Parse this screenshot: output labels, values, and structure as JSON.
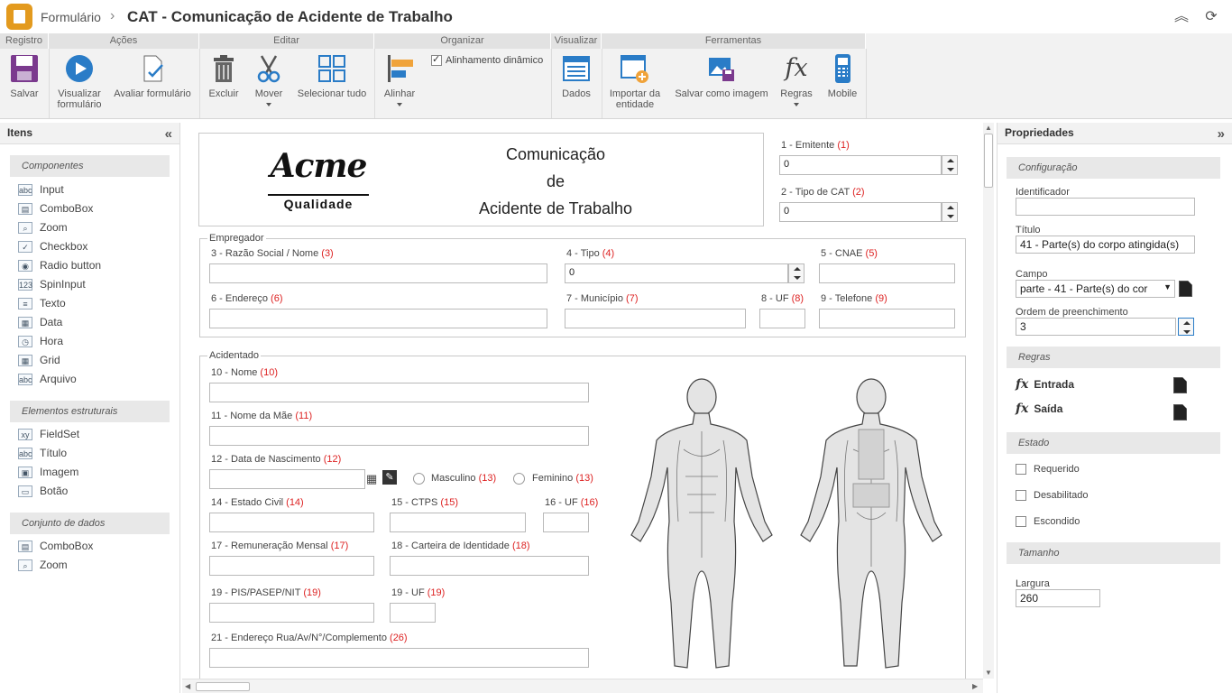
{
  "header": {
    "breadcrumb": "Formulário",
    "title": "CAT - Comunicação de Acidente de Trabalho"
  },
  "ribbon": {
    "groups": [
      "Registro",
      "Ações",
      "Editar",
      "Organizar",
      "Visualizar",
      "Ferramentas"
    ],
    "save": "Salvar",
    "preview": "Visualizar formulário",
    "evaluate": "Avaliar formulário",
    "delete": "Excluir",
    "move": "Mover",
    "select_all": "Selecionar tudo",
    "align": "Alinhar",
    "dynamic_align": "Alinhamento dinâmico",
    "data": "Dados",
    "import_entity": "Importar da entidade",
    "save_image": "Salvar como imagem",
    "rules": "Regras",
    "mobile": "Mobile"
  },
  "left_panel": {
    "title": "Itens",
    "components_title": "Componentes",
    "components": [
      "Input",
      "ComboBox",
      "Zoom",
      "Checkbox",
      "Radio button",
      "SpinInput",
      "Texto",
      "Data",
      "Hora",
      "Grid",
      "Arquivo"
    ],
    "structural_title": "Elementos estruturais",
    "structural": [
      "FieldSet",
      "Título",
      "Imagem",
      "Botão"
    ],
    "dataset_title": "Conjunto de dados",
    "dataset": [
      "ComboBox",
      "Zoom"
    ]
  },
  "form": {
    "logo_text": "Acme",
    "logo_sub": "Qualidade",
    "heading_line1": "Comunicação",
    "heading_line2": "de",
    "heading_line3": "Acidente de Trabalho",
    "emitente_label": "1 - Emitente",
    "emitente_num": "(1)",
    "emitente_value": "0",
    "tipo_cat_label": "2 - Tipo de CAT",
    "tipo_cat_num": "(2)",
    "tipo_cat_value": "0",
    "empregador_legend": "Empregador",
    "razao_label": "3 - Razão Social / Nome",
    "razao_num": "(3)",
    "tipo_label": "4 - Tipo",
    "tipo_num": "(4)",
    "tipo_value": "0",
    "cnae_label": "5 - CNAE",
    "cnae_num": "(5)",
    "endereco_label": "6 - Endereço",
    "endereco_num": "(6)",
    "municipio_label": "7 - Município",
    "municipio_num": "(7)",
    "uf_label": "8 - UF",
    "uf_num": "(8)",
    "telefone_label": "9 - Telefone",
    "telefone_num": "(9)",
    "acidentado_legend": "Acidentado",
    "nome_label": "10 - Nome",
    "nome_num": "(10)",
    "mae_label": "11 - Nome da Mãe",
    "mae_num": "(11)",
    "nasc_label": "12 - Data de Nascimento",
    "nasc_num": "(12)",
    "masc_label": "Masculino",
    "masc_num": "(13)",
    "fem_label": "Feminino",
    "fem_num": "(13)",
    "civil_label": "14 - Estado Civil",
    "civil_num": "(14)",
    "ctps_label": "15 - CTPS",
    "ctps_num": "(15)",
    "uf16_label": "16 - UF",
    "uf16_num": "(16)",
    "remun_label": "17 - Remuneração Mensal",
    "remun_num": "(17)",
    "rg_label": "18 - Carteira de Identidade",
    "rg_num": "(18)",
    "pis_label": "19 - PIS/PASEP/NIT",
    "pis_num": "(19)",
    "uf19_label": "19 - UF",
    "uf19_num": "(19)",
    "end_rua_label": "21 - Endereço Rua/Av/N°/Complemento",
    "end_rua_num": "(26)"
  },
  "right_panel": {
    "title": "Propriedades",
    "config_title": "Configuração",
    "identificador_label": "Identificador",
    "identificador_value": "",
    "titulo_label": "Título",
    "titulo_value": "41 - Parte(s) do corpo atingida(s)",
    "campo_label": "Campo",
    "campo_value": "parte - 41 - Parte(s) do cor",
    "ordem_label": "Ordem de preenchimento",
    "ordem_value": "3",
    "regras_title": "Regras",
    "entrada_label": "Entrada",
    "saida_label": "Saída",
    "estado_title": "Estado",
    "requerido_label": "Requerido",
    "desabilitado_label": "Desabilitado",
    "escondido_label": "Escondido",
    "tamanho_title": "Tamanho",
    "largura_label": "Largura",
    "largura_value": "260"
  }
}
